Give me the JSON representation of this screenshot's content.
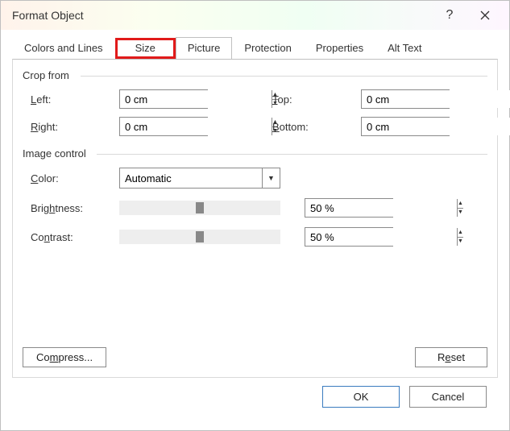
{
  "window": {
    "title": "Format Object"
  },
  "tabs": {
    "colors": "Colors and Lines",
    "size": "Size",
    "picture": "Picture",
    "protection": "Protection",
    "properties": "Properties",
    "alttext": "Alt Text"
  },
  "crop": {
    "group": "Crop from",
    "left_label": "Left:",
    "right_label": "Right:",
    "top_label": "Top:",
    "bottom_label": "Bottom:",
    "left": "0 cm",
    "right": "0 cm",
    "top": "0 cm",
    "bottom": "0 cm"
  },
  "image": {
    "group": "Image control",
    "color_label": "Color:",
    "color_value": "Automatic",
    "brightness_label": "Brightness:",
    "brightness_value": "50 %",
    "contrast_label": "Contrast:",
    "contrast_value": "50 %"
  },
  "buttons": {
    "compress": "Compress...",
    "reset": "Reset",
    "ok": "OK",
    "cancel": "Cancel"
  }
}
